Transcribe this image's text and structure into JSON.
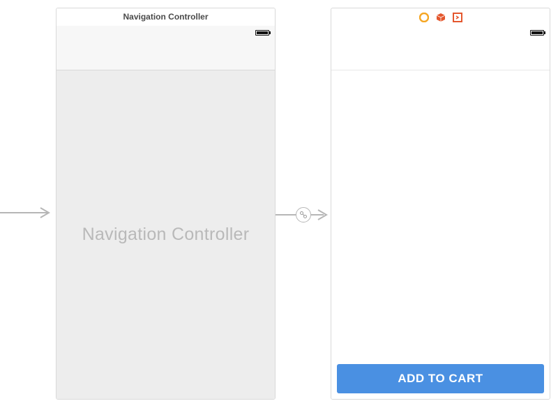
{
  "entry_arrow": {
    "visible": true
  },
  "segue": {
    "type": "relationship",
    "visible": true
  },
  "left_scene": {
    "title": "Navigation Controller",
    "placeholder": "Navigation Controller"
  },
  "right_scene": {
    "dock_icons": {
      "vc": "view-controller-icon",
      "first_responder": "first-responder-icon",
      "exit": "exit-icon"
    },
    "button_label": "ADD TO CART"
  },
  "colors": {
    "button_bg": "#4a90e2",
    "button_fg": "#ffffff",
    "placeholder_fg": "#b9b9b9"
  }
}
